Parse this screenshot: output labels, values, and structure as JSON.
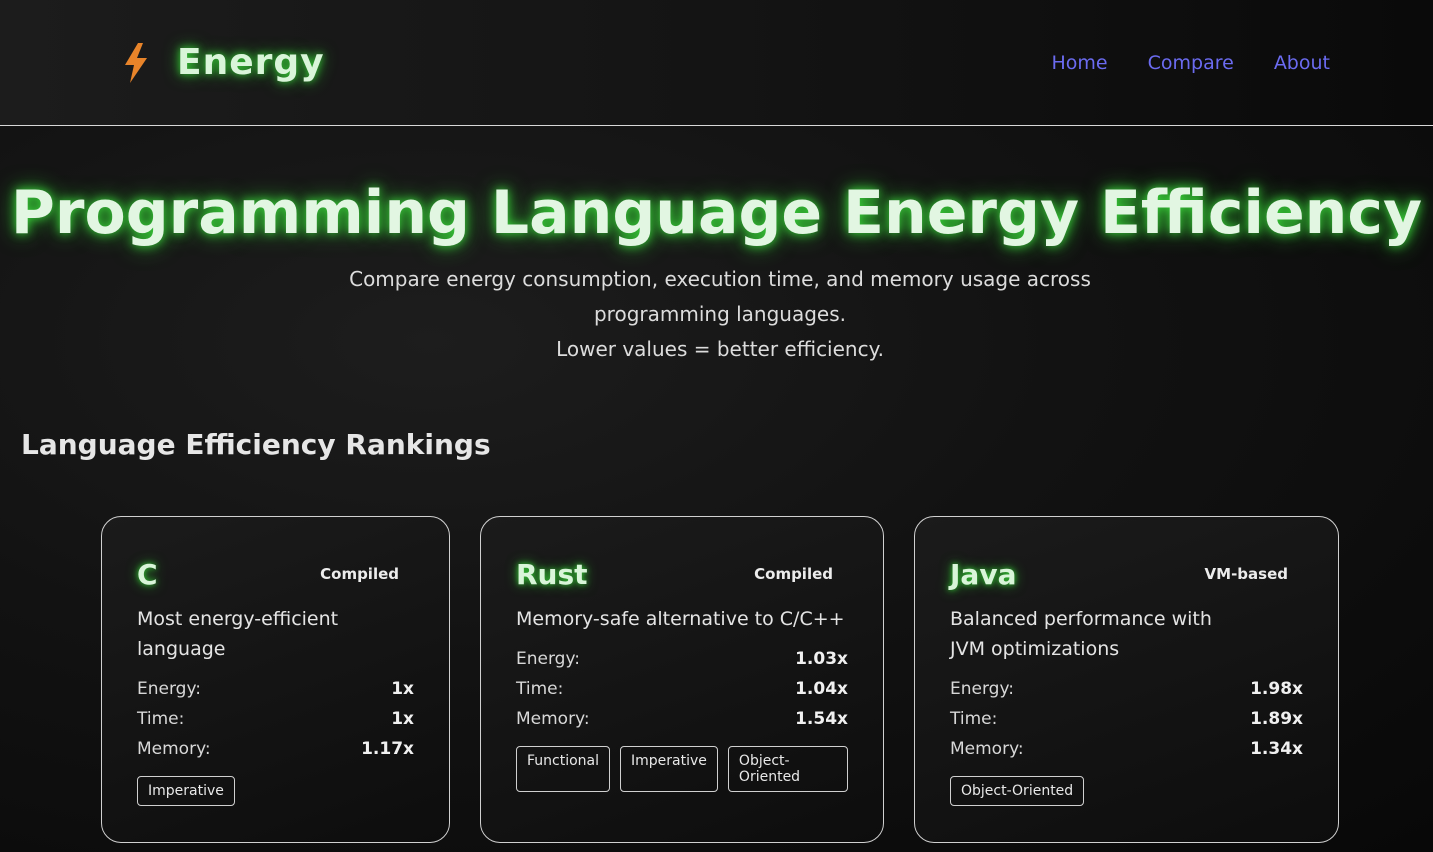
{
  "header": {
    "brand": "Energy",
    "nav": [
      "Home",
      "Compare",
      "About"
    ]
  },
  "hero": {
    "title": "Programming Language Energy Efficiency",
    "subtitle_line1": "Compare energy consumption, execution time, and memory usage across",
    "subtitle_line2": "programming languages.",
    "subtitle_line3": "Lower values = better efficiency."
  },
  "rankings": {
    "title": "Language Efficiency Rankings",
    "cards": [
      {
        "name": "C",
        "type": "Compiled",
        "description": "Most energy-efficient language",
        "energy_label": "Energy:",
        "energy": "1x",
        "time_label": "Time:",
        "time": "1x",
        "memory_label": "Memory:",
        "memory": "1.17x",
        "tags": [
          "Imperative"
        ]
      },
      {
        "name": "Rust",
        "type": "Compiled",
        "description": "Memory-safe alternative to C/C++",
        "energy_label": "Energy:",
        "energy": "1.03x",
        "time_label": "Time:",
        "time": "1.04x",
        "memory_label": "Memory:",
        "memory": "1.54x",
        "tags": [
          "Functional",
          "Imperative",
          "Object-Oriented"
        ]
      },
      {
        "name": "Java",
        "type": "VM-based",
        "description": "Balanced performance with JVM optimizations",
        "energy_label": "Energy:",
        "energy": "1.98x",
        "time_label": "Time:",
        "time": "1.89x",
        "memory_label": "Memory:",
        "memory": "1.34x",
        "tags": [
          "Object-Oriented"
        ]
      }
    ]
  },
  "colors": {
    "accent_glow": "#35c435",
    "nav_link": "#6b6bf0",
    "bolt": "#e8842a"
  },
  "icons": {
    "brand_icon": "lightning-bolt-icon"
  }
}
